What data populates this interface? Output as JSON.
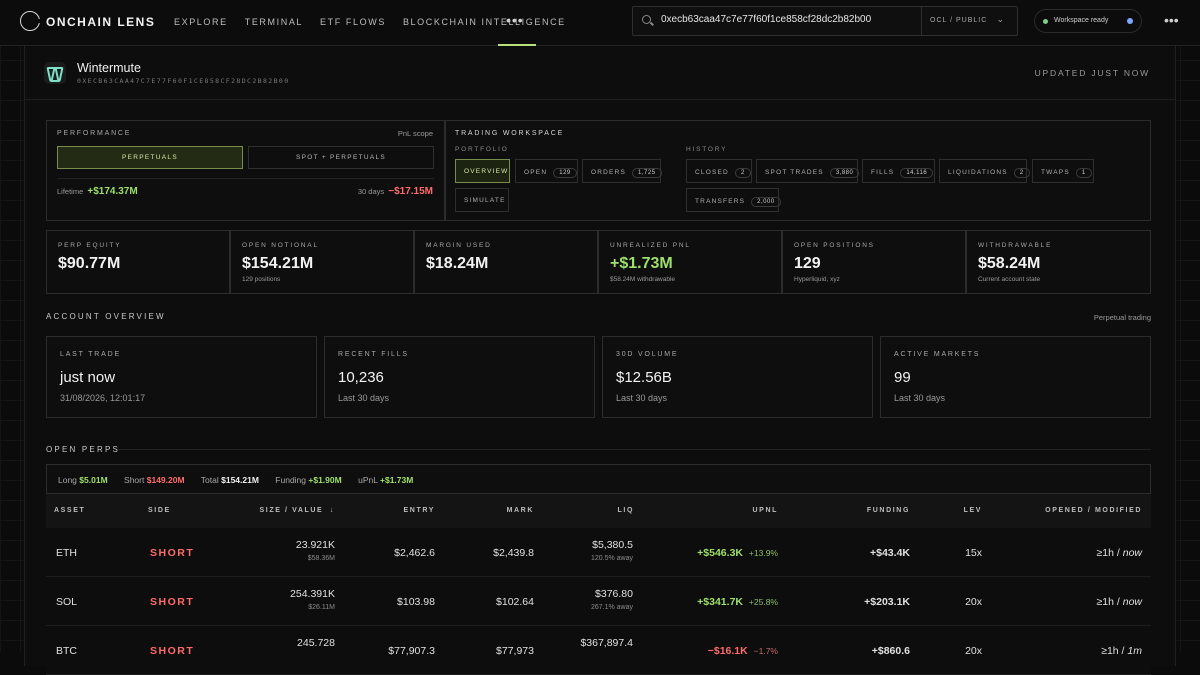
{
  "nav": {
    "brand": "ONCHAIN LENS",
    "links": [
      "EXPLORE",
      "TERMINAL",
      "ETF FLOWS",
      "BLOCKCHAIN INTELLIGENCE"
    ],
    "more": "•••",
    "search_value": "0xecb63caa47c7e77f60f1ce858cf28dc2b82b00",
    "scope": "OCL / PUBLIC",
    "workspace_status": "Workspace ready"
  },
  "entity": {
    "name": "Wintermute",
    "address": "0XECB63CAA47C7E77F60F1CE858CF28DC2B82B00",
    "updated": "UPDATED JUST NOW"
  },
  "performance": {
    "title": "PERFORMANCE",
    "pnl_scope": "PnL scope",
    "tabs": [
      "PERPETUALS",
      "SPOT + PERPETUALS"
    ],
    "lifetime_label": "Lifetime",
    "lifetime_value": "+$174.37M",
    "days_label": "30 days",
    "days_value": "−$17.15M"
  },
  "workspace": {
    "title": "TRADING WORKSPACE",
    "portfolio_label": "PORTFOLIO",
    "history_label": "HISTORY",
    "portfolio": [
      {
        "label": "OVERVIEW",
        "count": ""
      },
      {
        "label": "OPEN",
        "count": "129"
      },
      {
        "label": "ORDERS",
        "count": "1,725"
      },
      {
        "label": "SIMULATE",
        "count": ""
      }
    ],
    "history": [
      {
        "label": "CLOSED",
        "count": "2"
      },
      {
        "label": "SPOT TRADES",
        "count": "3,880"
      },
      {
        "label": "FILLS",
        "count": "14,116"
      },
      {
        "label": "LIQUIDATIONS",
        "count": "2"
      },
      {
        "label": "TWAPS",
        "count": "1"
      },
      {
        "label": "TRANSFERS",
        "count": "2,000"
      }
    ]
  },
  "stats": [
    {
      "label": "PERP EQUITY",
      "value": "$90.77M",
      "sub": ""
    },
    {
      "label": "OPEN NOTIONAL",
      "value": "$154.21M",
      "sub": "129 positions"
    },
    {
      "label": "MARGIN USED",
      "value": "$18.24M",
      "sub": ""
    },
    {
      "label": "UNREALIZED PNL",
      "value": "+$1.73M",
      "sub": "$58.24M withdrawable"
    },
    {
      "label": "OPEN POSITIONS",
      "value": "129",
      "sub": "Hyperliquid, xyz"
    },
    {
      "label": "WITHDRAWABLE",
      "value": "$58.24M",
      "sub": "Current account state"
    }
  ],
  "account": {
    "title": "ACCOUNT OVERVIEW",
    "right": "Perpetual trading",
    "cards": [
      {
        "label": "LAST TRADE",
        "value": "just now",
        "sub": "31/08/2026, 12:01:17"
      },
      {
        "label": "RECENT FILLS",
        "value": "10,236",
        "sub": "Last 30 days"
      },
      {
        "label": "30D VOLUME",
        "value": "$12.56B",
        "sub": "Last 30 days"
      },
      {
        "label": "ACTIVE MARKETS",
        "value": "99",
        "sub": "Last 30 days"
      }
    ]
  },
  "perps": {
    "title": "OPEN PERPS",
    "summary": {
      "long_label": "Long",
      "long_value": "$5.01M",
      "short_label": "Short",
      "short_value": "$149.20M",
      "total_label": "Total",
      "total_value": "$154.21M",
      "funding_label": "Funding",
      "funding_value": "+$1.90M",
      "upnl_label": "uPnL",
      "upnl_value": "+$1.73M"
    },
    "columns": [
      "ASSET",
      "SIDE",
      "SIZE / VALUE",
      "ENTRY",
      "MARK",
      "LIQ",
      "UPNL",
      "FUNDING",
      "LEV",
      "OPENED / MODIFIED"
    ],
    "sort_arrow": "↓",
    "rows": [
      {
        "asset": "ETH",
        "side": "SHORT",
        "size": "23.921K",
        "value": "$58.36M",
        "entry": "$2,462.6",
        "mark": "$2,439.8",
        "liq": "$5,380.5",
        "liq_away": "120.5% away",
        "upnl": "+$546.3K",
        "upnl_pct": "+13.9%",
        "funding": "+$43.4K",
        "lev": "15x",
        "opened": "≥1h",
        "modified": "now"
      },
      {
        "asset": "SOL",
        "side": "SHORT",
        "size": "254.391K",
        "value": "$26.11M",
        "entry": "$103.98",
        "mark": "$102.64",
        "liq": "$376.80",
        "liq_away": "267.1% away",
        "upnl": "+$341.7K",
        "upnl_pct": "+25.8%",
        "funding": "+$203.1K",
        "lev": "20x",
        "opened": "≥1h",
        "modified": "now"
      },
      {
        "asset": "BTC",
        "side": "SHORT",
        "size": "245.728",
        "value": "",
        "entry": "$77,907.3",
        "mark": "$77,973",
        "liq": "$367,897.4",
        "liq_away": "",
        "upnl": "−$16.1K",
        "upnl_pct": "−1.7%",
        "funding": "+$860.6",
        "lev": "20x",
        "opened": "≥1h",
        "modified": "1m"
      }
    ]
  }
}
